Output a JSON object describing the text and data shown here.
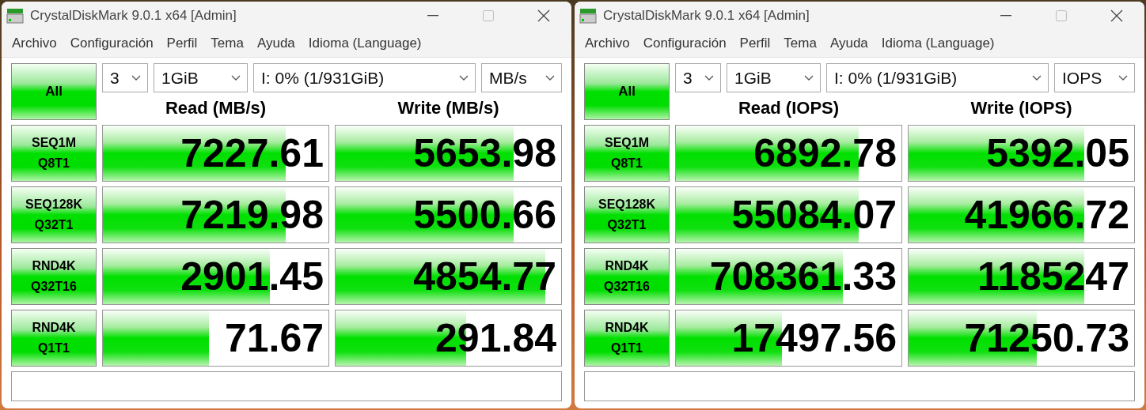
{
  "windows": [
    {
      "title": "CrystalDiskMark 9.0.1 x64 [Admin]",
      "menu": [
        "Archivo",
        "Configuración",
        "Perfil",
        "Tema",
        "Ayuda",
        "Idioma (Language)"
      ],
      "all_button": "All",
      "selects": [
        "3",
        "1GiB",
        "I: 0% (1/931GiB)",
        "MB/s"
      ],
      "columns": [
        "Read (MB/s)",
        "Write (MB/s)"
      ],
      "rows": [
        {
          "label": "SEQ1M",
          "sublabel": "Q8T1",
          "results": [
            {
              "value": "7227.61",
              "level": 0.81
            },
            {
              "value": "5653.98",
              "level": 0.79
            }
          ]
        },
        {
          "label": "SEQ128K",
          "sublabel": "Q32T1",
          "results": [
            {
              "value": "7219.98",
              "level": 0.81
            },
            {
              "value": "5500.66",
              "level": 0.79
            }
          ]
        },
        {
          "label": "RND4K",
          "sublabel": "Q32T16",
          "results": [
            {
              "value": "2901.45",
              "level": 0.74
            },
            {
              "value": "4854.77",
              "level": 0.93
            }
          ]
        },
        {
          "label": "RND4K",
          "sublabel": "Q1T1",
          "results": [
            {
              "value": "71.67",
              "level": 0.47
            },
            {
              "value": "291.84",
              "level": 0.58
            }
          ]
        }
      ]
    },
    {
      "title": "CrystalDiskMark 9.0.1 x64 [Admin]",
      "menu": [
        "Archivo",
        "Configuración",
        "Perfil",
        "Tema",
        "Ayuda",
        "Idioma (Language)"
      ],
      "all_button": "All",
      "selects": [
        "3",
        "1GiB",
        "I: 0% (1/931GiB)",
        "IOPS"
      ],
      "columns": [
        "Read (IOPS)",
        "Write (IOPS)"
      ],
      "rows": [
        {
          "label": "SEQ1M",
          "sublabel": "Q8T1",
          "results": [
            {
              "value": "6892.78",
              "level": 0.81
            },
            {
              "value": "5392.05",
              "level": 0.78
            }
          ]
        },
        {
          "label": "SEQ128K",
          "sublabel": "Q32T1",
          "results": [
            {
              "value": "55084.07",
              "level": 0.81
            },
            {
              "value": "41966.72",
              "level": 0.78
            }
          ]
        },
        {
          "label": "RND4K",
          "sublabel": "Q32T16",
          "results": [
            {
              "value": "708361.33",
              "level": 0.74
            },
            {
              "value": "1185247",
              "level": 0.78
            }
          ]
        },
        {
          "label": "RND4K",
          "sublabel": "Q1T1",
          "results": [
            {
              "value": "17497.56",
              "level": 0.47
            },
            {
              "value": "71250.73",
              "level": 0.57
            }
          ]
        }
      ]
    }
  ]
}
